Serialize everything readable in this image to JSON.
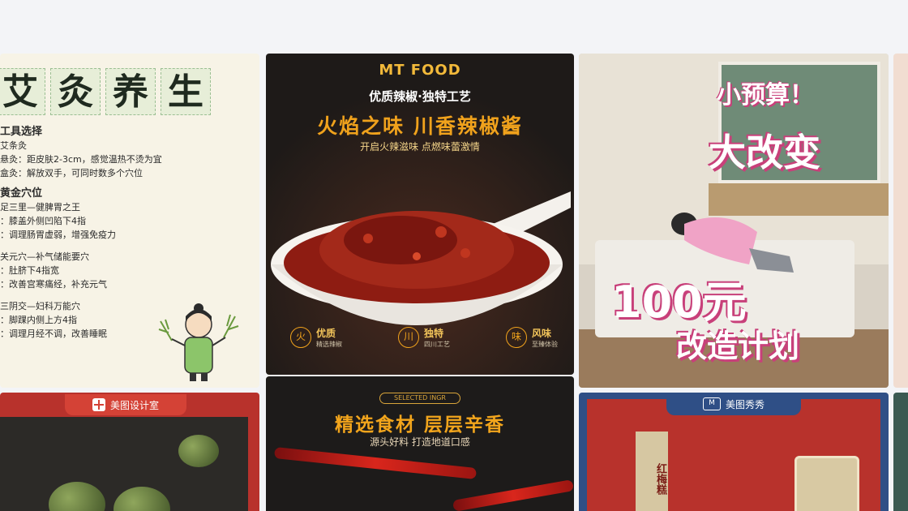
{
  "cards": {
    "moxa": {
      "title_chars": [
        "艾",
        "灸",
        "养",
        "生"
      ],
      "sections": [
        {
          "heading": "工具选择",
          "lines": [
            "艾条灸",
            "悬灸：距皮肤2-3cm，感觉温热不烫为宜",
            "盒灸：解放双手，可同时数多个穴位"
          ]
        },
        {
          "heading": "黄金穴位",
          "lines": [
            "足三里—健脾胃之王",
            "：膝盖外侧凹陷下4指",
            "：调理肠胃虚弱，增强免疫力"
          ]
        },
        {
          "heading": "",
          "lines": [
            "关元穴—补气储能要穴",
            "：肚脐下4指宽",
            "：改善宫寒痛经，补充元气"
          ]
        },
        {
          "heading": "",
          "lines": [
            "三阴交—妇科万能穴",
            "：脚踝内侧上方4指",
            "：调理月经不调，改善睡眠"
          ]
        }
      ]
    },
    "sauce": {
      "brand": "MT FOOD",
      "subtitle": "优质辣椒·独特工艺",
      "title": "火焰之味 川香辣椒酱",
      "tagline": "开启火辣滋味 点燃味蕾激情",
      "features": [
        {
          "icon": "火",
          "label": "优质",
          "desc": "精选辣椒"
        },
        {
          "icon": "川",
          "label": "独特",
          "desc": "四川工艺"
        },
        {
          "icon": "味",
          "label": "风味",
          "desc": "至臻体验"
        }
      ]
    },
    "room": {
      "line1": "小预算！",
      "line2": "大改变",
      "line3": "100元",
      "line4": "改造计划"
    },
    "design": {
      "badge": "美图设计室"
    },
    "ingredients": {
      "tag": "SELECTED INGR",
      "title": "精选食材 层层辛香",
      "subtitle": "源头好料 打造地道口感"
    },
    "meitu": {
      "badge": "美图秀秀",
      "icon_text": "M",
      "sign": "红梅糕"
    }
  },
  "colors": {
    "accent_orange": "#f0a21c",
    "accent_pink": "#c8407a",
    "badge_red": "#d44236",
    "badge_blue": "#2f4f86"
  }
}
